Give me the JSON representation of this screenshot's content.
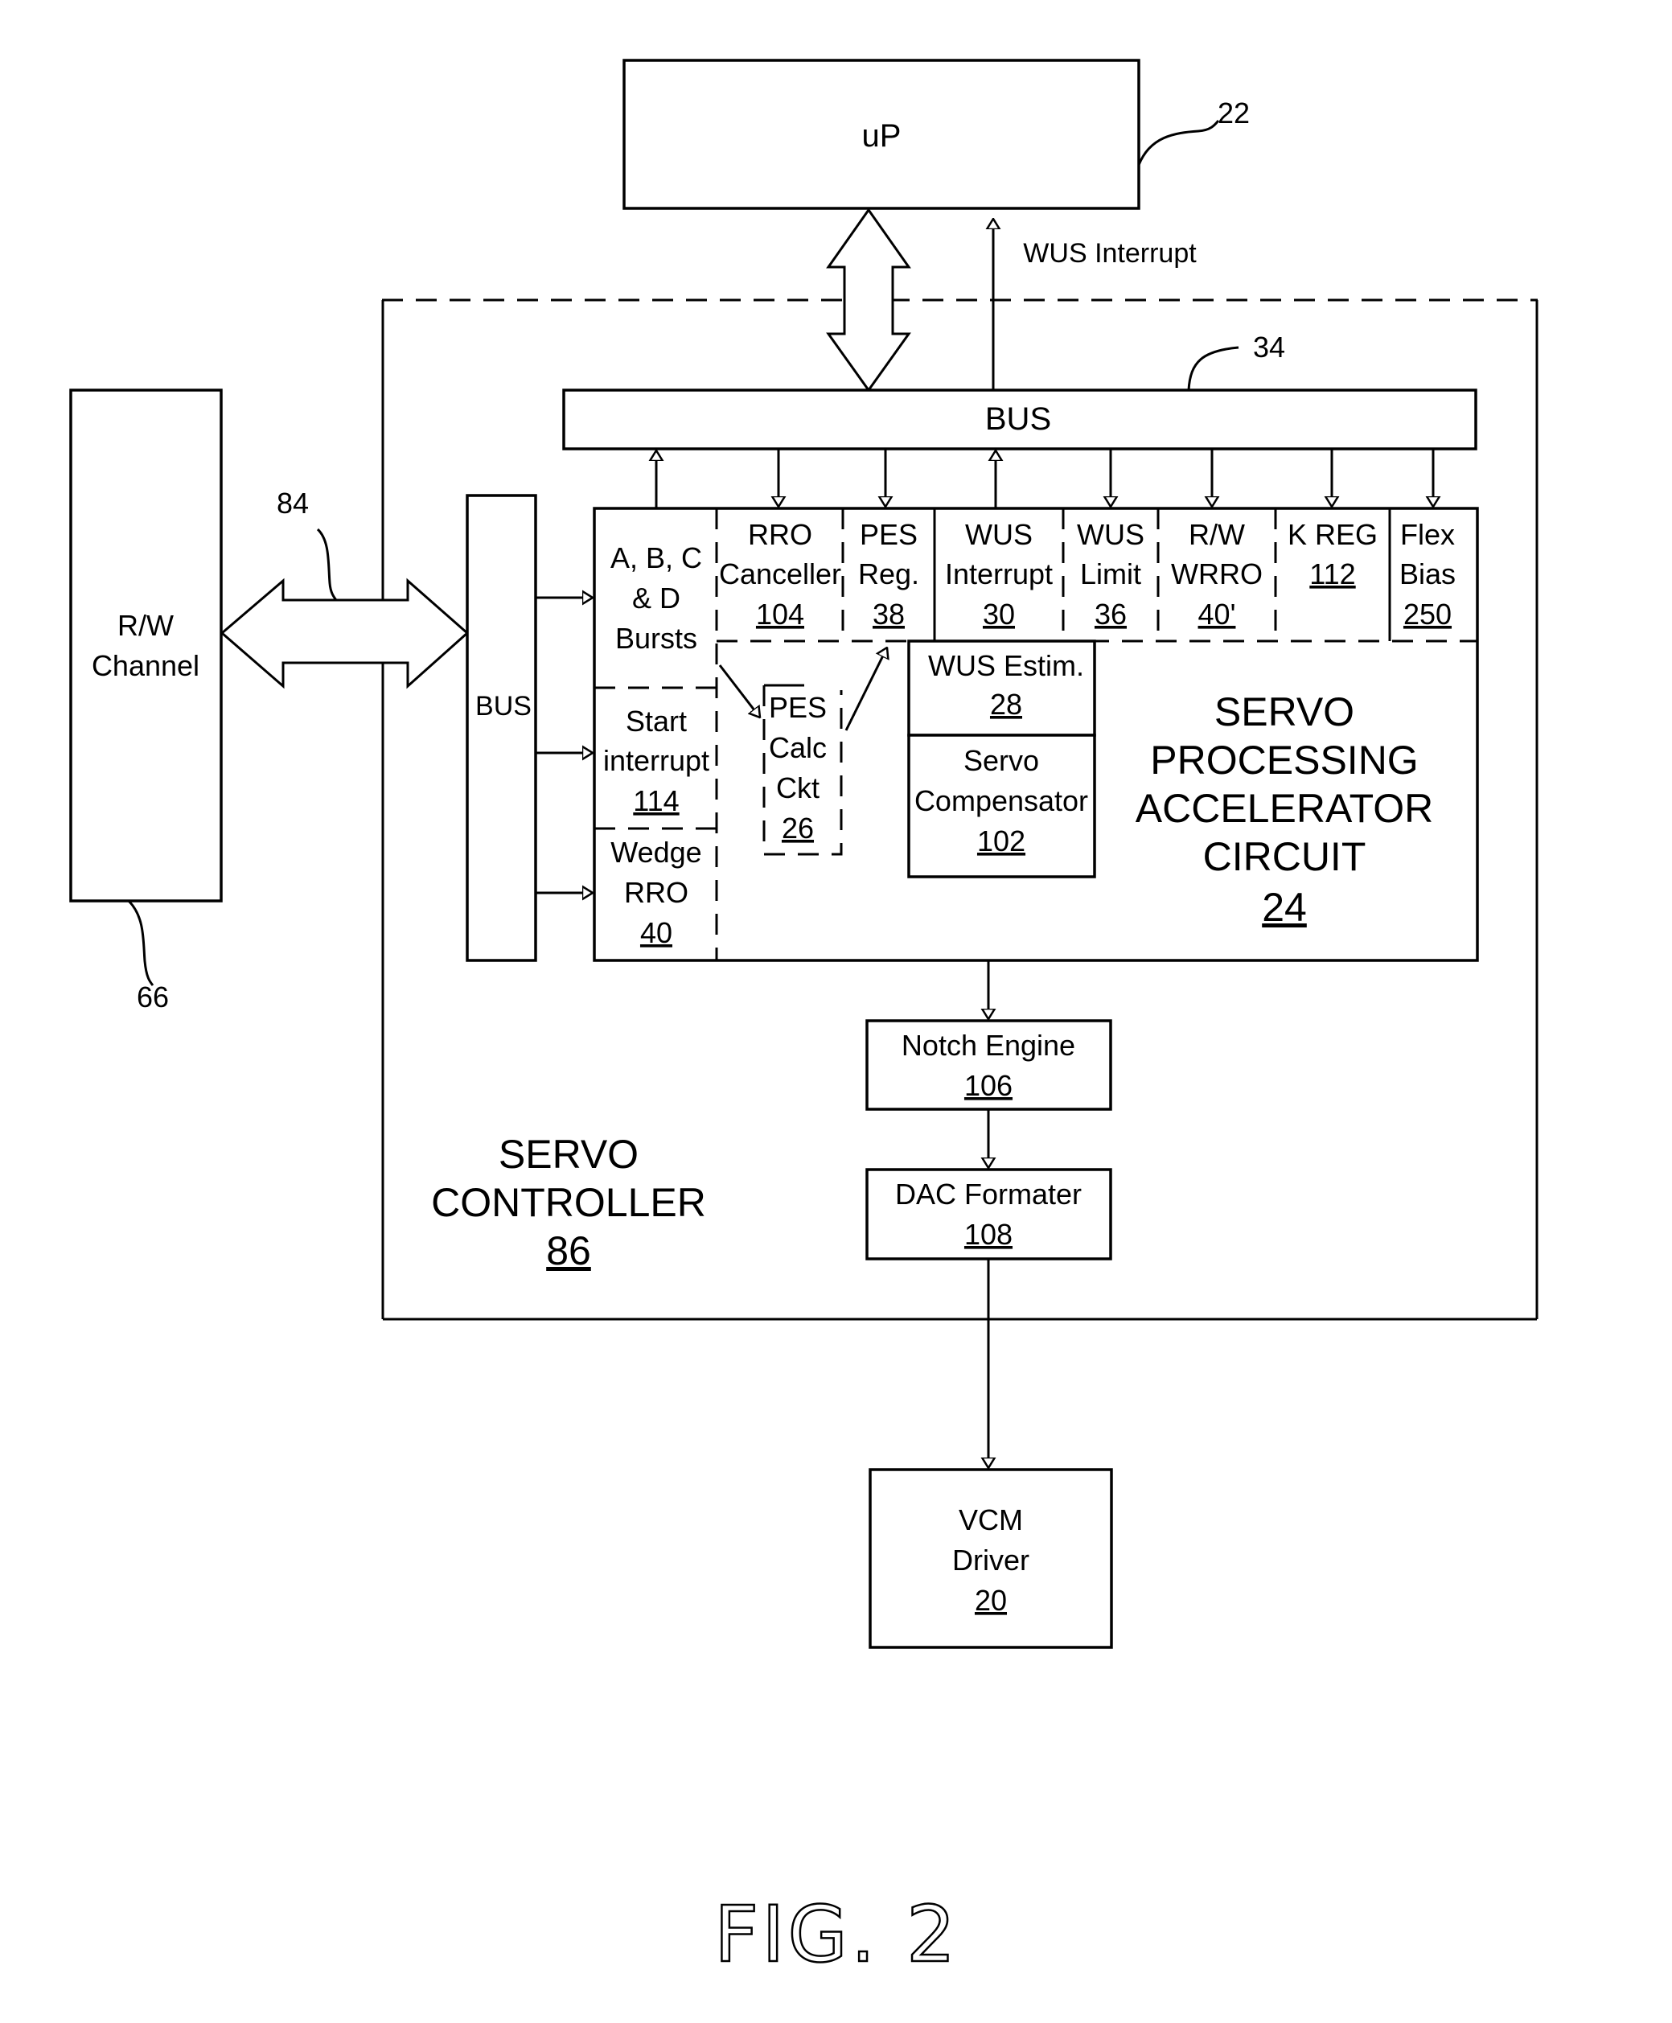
{
  "figure": {
    "label": "FIG. 2"
  },
  "blocks": {
    "up": {
      "label": "uP",
      "ref": "22"
    },
    "rw_channel": {
      "line1": "R/W",
      "line2": "Channel",
      "ref": "66"
    },
    "link_ref": "84",
    "left_bus": {
      "label": "BUS"
    },
    "main_bus": {
      "label": "BUS",
      "ref": "34"
    },
    "wus_interrupt_signal": "WUS Interrupt",
    "servo_controller": {
      "line1": "SERVO",
      "line2": "CONTROLLER",
      "ref": "86"
    },
    "accelerator": {
      "line1": "SERVO",
      "line2": "PROCESSING",
      "line3": "ACCELERATOR",
      "line4": "CIRCUIT",
      "ref": "24"
    },
    "bursts": {
      "line1": "A, B, C",
      "line2": "& D",
      "line3": "Bursts"
    },
    "start_interrupt": {
      "line1": "Start",
      "line2": "interrupt",
      "ref": "114"
    },
    "wedge_rro": {
      "line1": "Wedge",
      "line2": "RRO",
      "ref": "40"
    },
    "registers": [
      {
        "line1": "RRO",
        "line2": "Canceller",
        "ref": "104"
      },
      {
        "line1": "PES",
        "line2": "Reg.",
        "ref": "38"
      },
      {
        "line1": "WUS",
        "line2": "Interrupt",
        "ref": "30"
      },
      {
        "line1": "WUS",
        "line2": "Limit",
        "ref": "36"
      },
      {
        "line1": "R/W",
        "line2": "WRRO",
        "ref": "40'"
      },
      {
        "line1": "K REG",
        "line2": "",
        "ref": "112"
      },
      {
        "line1": "Flex",
        "line2": "Bias",
        "ref": "250"
      }
    ],
    "pes_calc": {
      "line1": "PES",
      "line2": "Calc",
      "line3": "Ckt",
      "ref": "26"
    },
    "wus_estim": {
      "label": "WUS Estim.",
      "ref": "28"
    },
    "servo_comp": {
      "line1": "Servo",
      "line2": "Compensator",
      "ref": "102"
    },
    "notch": {
      "label": "Notch Engine",
      "ref": "106"
    },
    "dac": {
      "label": "DAC Formater",
      "ref": "108"
    },
    "vcm": {
      "line1": "VCM",
      "line2": "Driver",
      "ref": "20"
    }
  }
}
